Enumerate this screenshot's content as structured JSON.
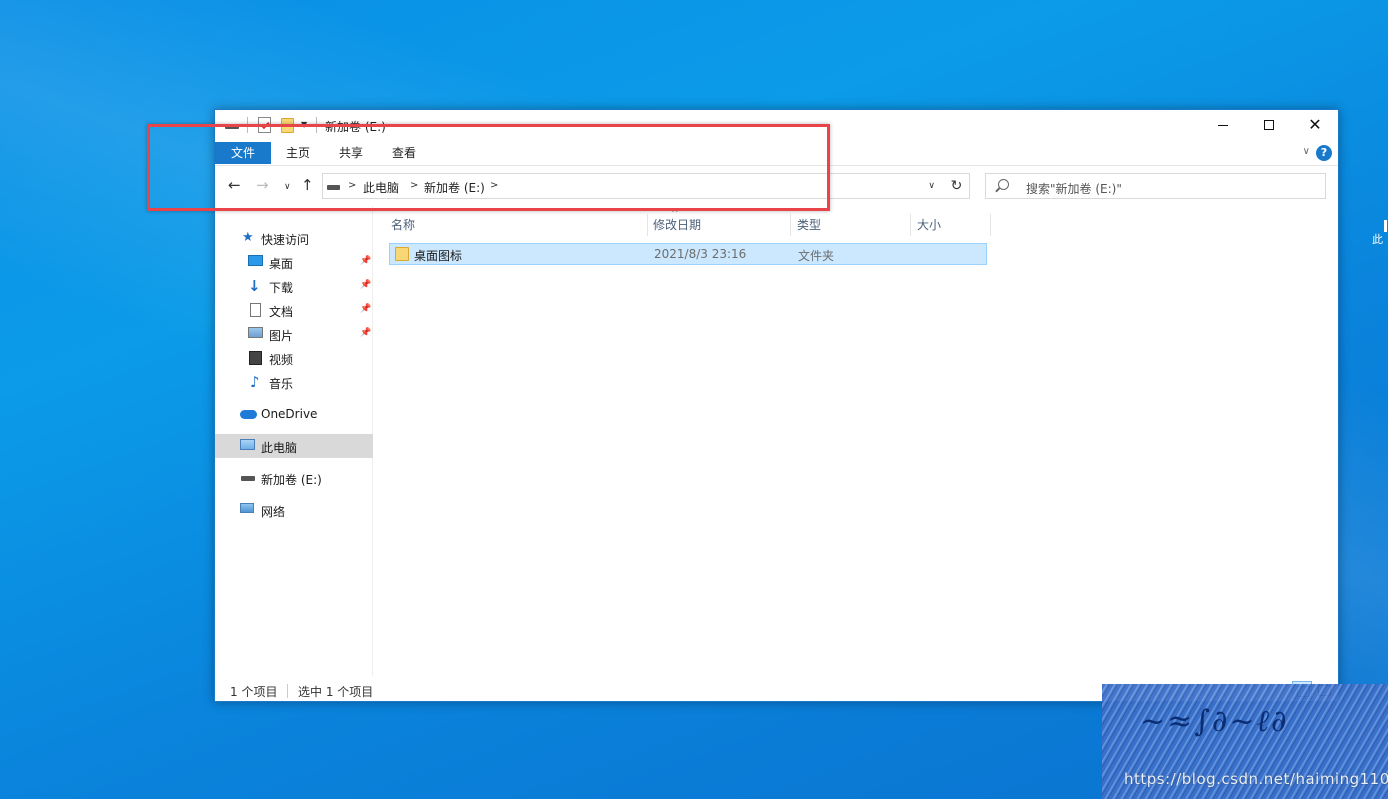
{
  "window": {
    "title": "新加卷 (E:)"
  },
  "ribbon": {
    "tabs": [
      "文件",
      "主页",
      "共享",
      "查看"
    ]
  },
  "navigation": {
    "breadcrumb": [
      "此电脑",
      "新加卷 (E:)"
    ],
    "search_placeholder": "搜索\"新加卷 (E:)\""
  },
  "sidebar": {
    "quick_access": "快速访问",
    "items": [
      {
        "label": "桌面",
        "icon": "desktop-icon",
        "pinned": true
      },
      {
        "label": "下载",
        "icon": "download-icon",
        "pinned": true
      },
      {
        "label": "文档",
        "icon": "document-icon",
        "pinned": true
      },
      {
        "label": "图片",
        "icon": "picture-icon",
        "pinned": true
      },
      {
        "label": "视频",
        "icon": "video-icon",
        "pinned": false
      },
      {
        "label": "音乐",
        "icon": "music-icon",
        "pinned": false
      }
    ],
    "onedrive": "OneDrive",
    "this_pc": "此电脑",
    "drive": "新加卷 (E:)",
    "network": "网络"
  },
  "columns": {
    "name": "名称",
    "date": "修改日期",
    "type": "类型",
    "size": "大小"
  },
  "files": [
    {
      "name": "桌面图标",
      "date": "2021/8/3 23:16",
      "type": "文件夹",
      "size": ""
    }
  ],
  "status": {
    "count": "1 个项目",
    "selected": "选中 1 个项目"
  },
  "desktop": {
    "edge_text": "此"
  },
  "watermark": {
    "text": "https://blog.csdn.net/haiming110"
  },
  "colors": {
    "accent": "#1979ca",
    "selection": "#cce8ff",
    "highlight_box": "#e8454a",
    "desktop": "#0a8fe6"
  }
}
